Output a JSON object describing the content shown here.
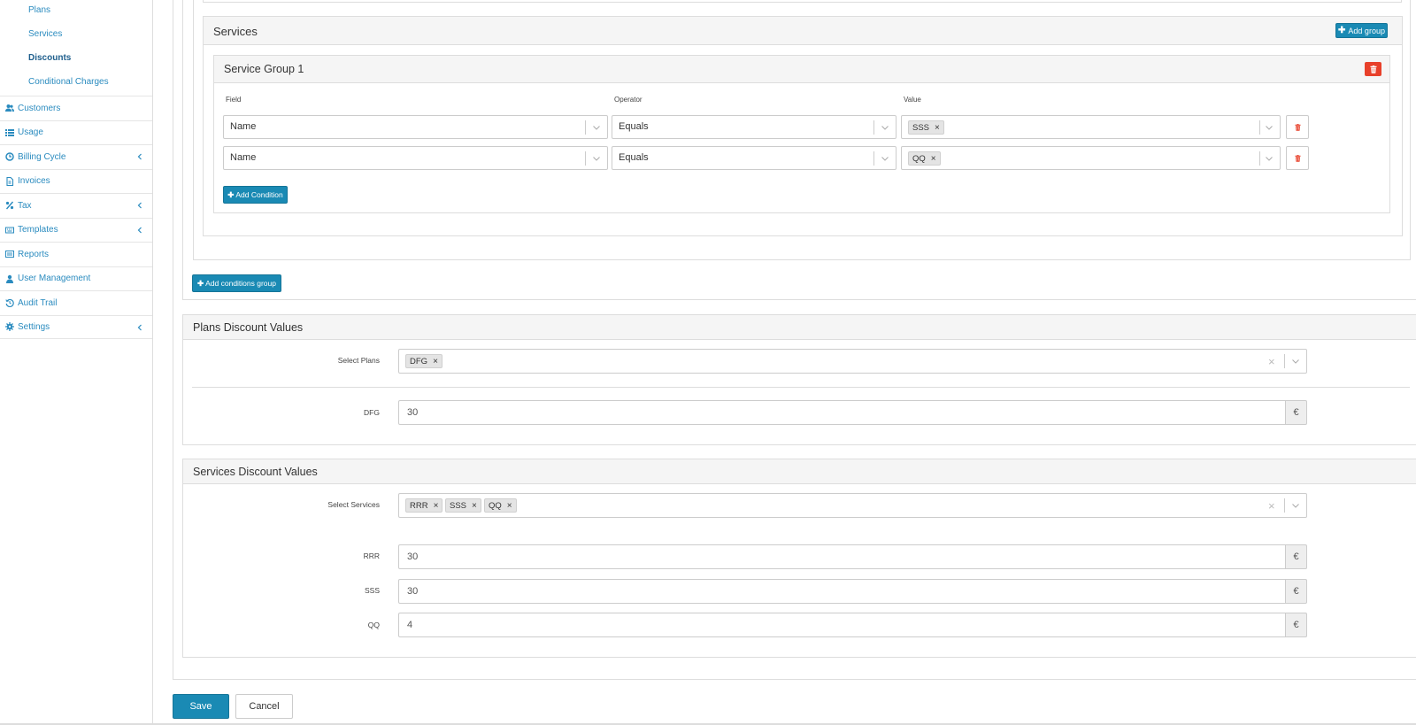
{
  "sidebar": {
    "sub_items": [
      {
        "label": "Plans",
        "active": false
      },
      {
        "label": "Services",
        "active": false
      },
      {
        "label": "Discounts",
        "active": true
      },
      {
        "label": "Conditional Charges",
        "active": false
      }
    ],
    "items": [
      {
        "label": "Customers",
        "icon": "users-icon",
        "chevron": false
      },
      {
        "label": "Usage",
        "icon": "list-icon",
        "chevron": false
      },
      {
        "label": "Billing Cycle",
        "icon": "clock-icon",
        "chevron": true
      },
      {
        "label": "Invoices",
        "icon": "file-icon",
        "chevron": false
      },
      {
        "label": "Tax",
        "icon": "percent-icon",
        "chevron": true
      },
      {
        "label": "Templates",
        "icon": "keyboard-icon",
        "chevron": true
      },
      {
        "label": "Reports",
        "icon": "report-icon",
        "chevron": false
      },
      {
        "label": "User Management",
        "icon": "user-icon",
        "chevron": false
      },
      {
        "label": "Audit Trail",
        "icon": "history-icon",
        "chevron": false
      },
      {
        "label": "Settings",
        "icon": "gear-icon",
        "chevron": true
      }
    ]
  },
  "services_panel": {
    "title": "Services",
    "add_group_label": "Add group",
    "group": {
      "title": "Service Group 1",
      "columns": {
        "field": "Field",
        "operator": "Operator",
        "value": "Value"
      },
      "rows": [
        {
          "field": "Name",
          "operator": "Equals",
          "value_tag": "SSS"
        },
        {
          "field": "Name",
          "operator": "Equals",
          "value_tag": "QQ"
        }
      ],
      "add_condition_label": "Add Condition"
    }
  },
  "add_conditions_group_label": "Add conditions group",
  "plans_discount": {
    "title": "Plans Discount Values",
    "select_label": "Select Plans",
    "selected": [
      "DFG"
    ],
    "values": [
      {
        "label": "DFG",
        "value": "30",
        "currency": "€"
      }
    ]
  },
  "services_discount": {
    "title": "Services Discount Values",
    "select_label": "Select Services",
    "selected": [
      "RRR",
      "SSS",
      "QQ"
    ],
    "values": [
      {
        "label": "RRR",
        "value": "30",
        "currency": "€"
      },
      {
        "label": "SSS",
        "value": "30",
        "currency": "€"
      },
      {
        "label": "QQ",
        "value": "4",
        "currency": "€"
      }
    ]
  },
  "actions": {
    "save": "Save",
    "cancel": "Cancel"
  },
  "colors": {
    "primary": "#1a8ab4",
    "danger": "#e8402a",
    "link": "#2a8bbf"
  }
}
